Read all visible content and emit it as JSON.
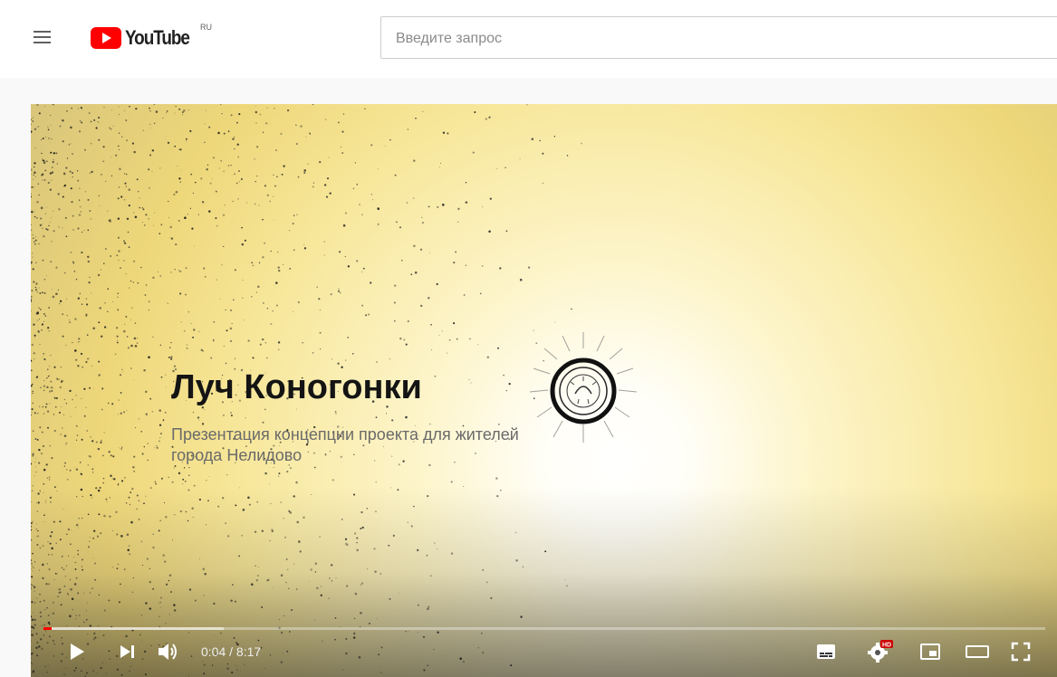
{
  "header": {
    "logo_text": "YouTube",
    "country_code": "RU",
    "search_placeholder": "Введите запрос"
  },
  "player": {
    "title": "Луч Коногонки",
    "subtitle": "Презентация концепции проекта для жителей города Нелидово",
    "time_current": "0:04",
    "time_separator": " / ",
    "time_total": "8:17",
    "progress_played_fraction": 0.008,
    "progress_loaded_fraction": 0.18,
    "hd_badge": "HD"
  },
  "icons": {
    "menu": "hamburger-menu-icon",
    "logo": "youtube-logo-icon",
    "play": "play-icon",
    "next": "next-icon",
    "volume": "volume-icon",
    "subtitles": "subtitles-icon",
    "settings": "settings-icon",
    "miniplayer": "miniplayer-icon",
    "theater": "theater-mode-icon",
    "fullscreen": "fullscreen-icon"
  },
  "colors": {
    "brand_red": "#ff0000",
    "text_dark": "#212121"
  }
}
